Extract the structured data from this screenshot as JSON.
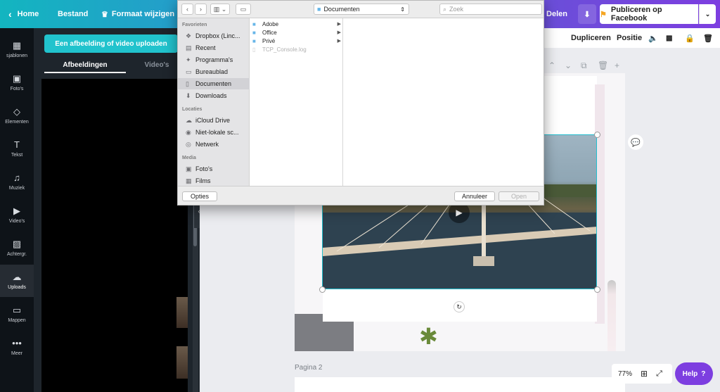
{
  "topbar": {
    "home": "Home",
    "file": "Bestand",
    "resize": "Formaat wijzigen",
    "share": "Delen",
    "publish": "Publiceren op Facebook"
  },
  "rail": [
    {
      "label": "sjablonen",
      "icon": "layout-icon"
    },
    {
      "label": "Foto's",
      "icon": "photo-icon"
    },
    {
      "label": "Elementen",
      "icon": "elements-icon"
    },
    {
      "label": "Tekst",
      "icon": "text-icon"
    },
    {
      "label": "Muziek",
      "icon": "music-icon"
    },
    {
      "label": "Video's",
      "icon": "video-icon"
    },
    {
      "label": "Achtergr.",
      "icon": "background-icon"
    },
    {
      "label": "Uploads",
      "icon": "upload-icon"
    },
    {
      "label": "Mappen",
      "icon": "folder-icon"
    },
    {
      "label": "Meer",
      "icon": "more-icon"
    }
  ],
  "panel": {
    "upload_button": "Een afbeelding of video uploaden",
    "tab_images": "Afbeeldingen",
    "tab_videos": "Video's"
  },
  "toolbar2": {
    "duplicate": "Dupliceren",
    "position": "Positie"
  },
  "editor": {
    "page2_label": "Pagina 2",
    "zoom": "77%",
    "help": "Help"
  },
  "dialog": {
    "location": "Documenten",
    "search_placeholder": "Zoek",
    "favorites_header": "Favorieten",
    "favorites": [
      {
        "label": "Dropbox (Linc...",
        "icon": "dropbox-icon"
      },
      {
        "label": "Recent",
        "icon": "recent-icon"
      },
      {
        "label": "Programma's",
        "icon": "apps-icon"
      },
      {
        "label": "Bureaublad",
        "icon": "desktop-icon"
      },
      {
        "label": "Documenten",
        "icon": "documents-icon"
      },
      {
        "label": "Downloads",
        "icon": "downloads-icon"
      }
    ],
    "locations_header": "Locaties",
    "locations": [
      {
        "label": "iCloud Drive",
        "icon": "cloud-icon"
      },
      {
        "label": "Niet-lokale sc...",
        "icon": "disc-icon"
      },
      {
        "label": "Netwerk",
        "icon": "network-icon"
      }
    ],
    "media_header": "Media",
    "media": [
      {
        "label": "Foto's",
        "icon": "photos-icon"
      },
      {
        "label": "Films",
        "icon": "films-icon"
      }
    ],
    "files": [
      {
        "label": "Adobe",
        "type": "folder"
      },
      {
        "label": "Office",
        "type": "folder"
      },
      {
        "label": "Privé",
        "type": "folder"
      },
      {
        "label": "TCP_Console.log",
        "type": "file"
      }
    ],
    "options": "Opties",
    "cancel": "Annuleer",
    "open": "Open"
  },
  "colors": {
    "accent_teal": "#21c3cd",
    "accent_purple": "#7d3ee0",
    "publish_orange": "#f5a623"
  }
}
